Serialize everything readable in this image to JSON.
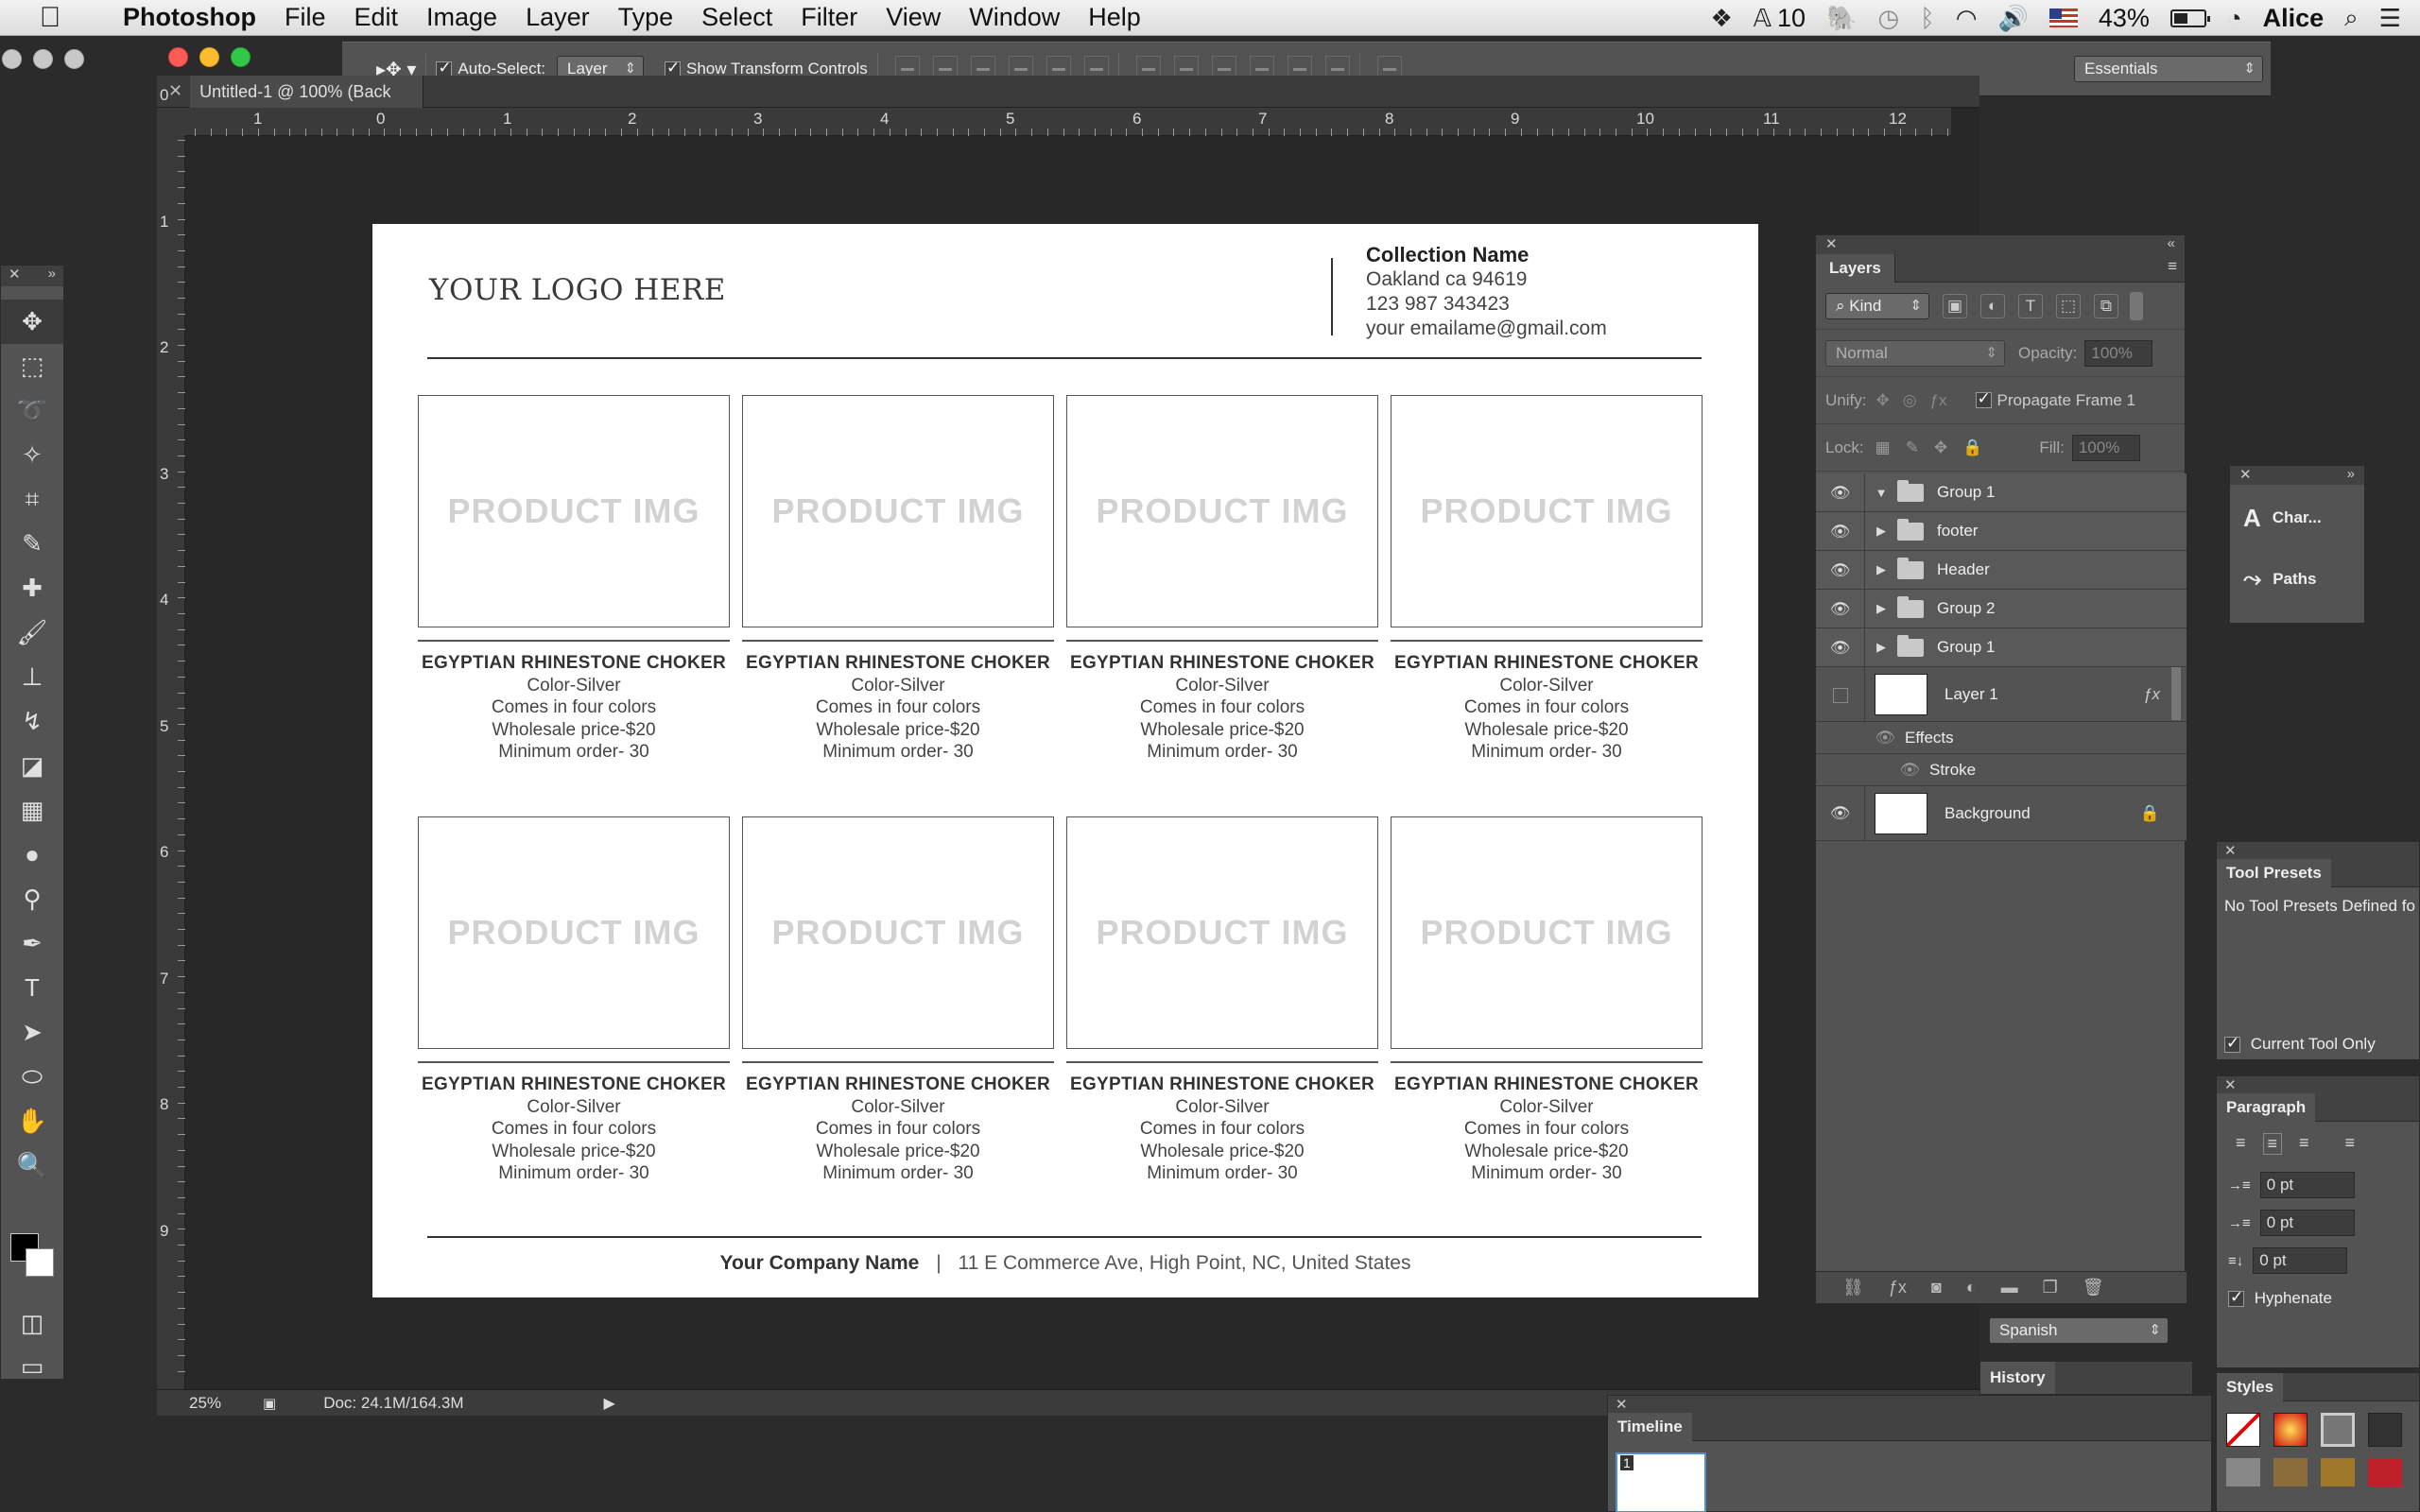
{
  "menubar": {
    "app": "Photoshop",
    "items": [
      "File",
      "Edit",
      "Image",
      "Layer",
      "Type",
      "Select",
      "Filter",
      "View",
      "Window",
      "Help"
    ],
    "status": {
      "font_count": "10",
      "battery": "43%",
      "user": "Alice"
    }
  },
  "options": {
    "auto_select_label": "Auto-Select:",
    "auto_select_value": "Layer",
    "transform_label": "Show Transform Controls",
    "workspace": "Essentials"
  },
  "doc_tabs": [
    {
      "label": "Untitled-1 @ 100% (Back",
      "active": false
    }
  ],
  "ruler": {
    "h": [
      "1",
      "0",
      "1",
      "2",
      "3",
      "4",
      "5",
      "6",
      "7",
      "8",
      "9",
      "10",
      "11",
      "12"
    ],
    "v": [
      "0",
      "1",
      "2",
      "3",
      "4",
      "5",
      "6",
      "7",
      "8",
      "9"
    ]
  },
  "status": {
    "zoom": "25%",
    "doc": "Doc: 24.1M/164.3M"
  },
  "page": {
    "logo": "YOUR LOGO HERE",
    "collection_name": "Collection Name",
    "address": "Oakland ca 94619",
    "phone": "123 987 343423",
    "email": "your emailame@gmail.com",
    "placeholder": "PRODUCT IMG",
    "product": {
      "name": "EGYPTIAN RHINESTONE CHOKER",
      "color": "Color-Silver",
      "variants": "Comes in four colors",
      "price": "Wholesale price-$20",
      "minimum": "Minimum order- 30"
    },
    "footer_company": "Your Company Name",
    "footer_sep": "|",
    "footer_address": "11 E Commerce Ave, High Point, NC, United States"
  },
  "layers_panel": {
    "title": "Layers",
    "filter_kind": "Kind",
    "blend_mode": "Normal",
    "opacity_label": "Opacity:",
    "opacity_value": "100%",
    "unify_label": "Unify:",
    "propagate_label": "Propagate Frame 1",
    "lock_label": "Lock:",
    "fill_label": "Fill:",
    "fill_value": "100%",
    "layers": [
      "Group 1",
      "footer",
      "Header",
      "Group 2",
      "Group 1",
      "Layer 1",
      "Effects",
      "Stroke",
      "Background"
    ]
  },
  "mini_panel": {
    "character": "Char...",
    "paths": "Paths"
  },
  "tool_presets": {
    "title": "Tool Presets",
    "empty": "No Tool Presets Defined fo",
    "current_only": "Current Tool Only"
  },
  "paragraph": {
    "title": "Paragraph",
    "indent_left": "0 pt",
    "indent_first": "0 pt",
    "space_after": "0 pt",
    "hyphenate": "Hyphenate",
    "language": "Spanish"
  },
  "styles": {
    "title": "Styles"
  },
  "history": {
    "title": "History"
  },
  "timeline": {
    "title": "Timeline",
    "frame": "1"
  }
}
